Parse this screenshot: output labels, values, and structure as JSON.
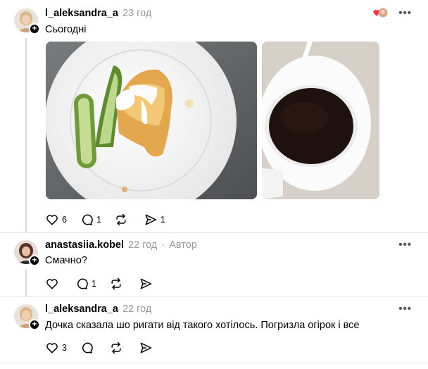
{
  "posts": [
    {
      "username": "l_aleksandra_a",
      "time": "23 год",
      "text": "Сьогодні",
      "actions": {
        "likes": "6",
        "replies": "1",
        "reposts": "",
        "shares": "1"
      }
    },
    {
      "username": "anastasiia.kobel",
      "time": "22 год",
      "author_tag": "Автор",
      "text": "Смачно?",
      "actions": {
        "likes": "",
        "replies": "1",
        "reposts": "",
        "shares": ""
      }
    },
    {
      "username": "l_aleksandra_a",
      "time": "22 год",
      "text": "Дочка сказала шо ригати від такого хотілось. Погризла огірок і все",
      "actions": {
        "likes": "3",
        "replies": "",
        "reposts": "",
        "shares": ""
      }
    }
  ],
  "more_label": "•••",
  "colors": {
    "like_heart": "#ff3040",
    "meta_gray": "#999999",
    "line_gray": "#d9d9d9"
  },
  "icons": [
    "heart-icon",
    "reply-icon",
    "repost-icon",
    "share-icon",
    "more-icon",
    "plus-icon"
  ]
}
